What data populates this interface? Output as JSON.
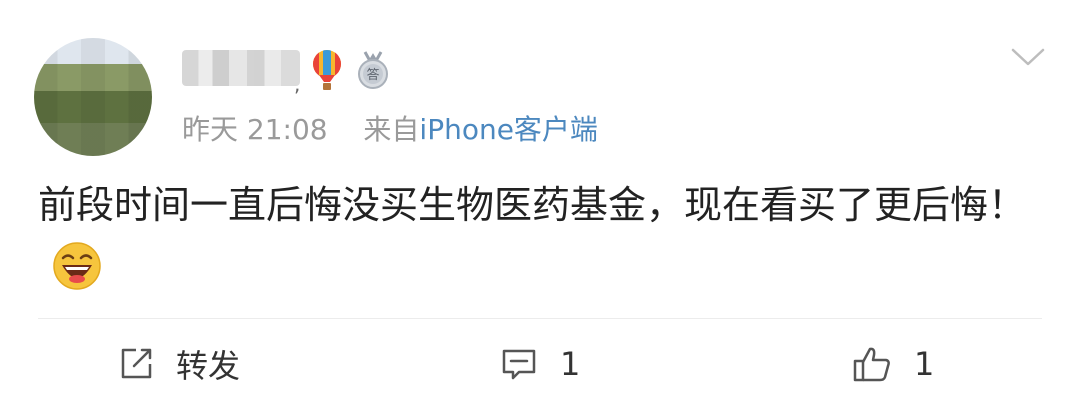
{
  "post": {
    "username_separator": ",",
    "time": "昨天 21:08",
    "source_prefix": "来自",
    "client": "iPhone客户端",
    "text": "前段时间一直后悔没买生物医药基金，现在看买了更后悔！",
    "medal_char": "答"
  },
  "actions": {
    "repost_label": "转发",
    "comment_count": "1",
    "like_count": "1"
  },
  "colors": {
    "client_link": "#4c88bf",
    "meta_gray": "#9a9a9a",
    "icon_gray": "#555555"
  },
  "icons": [
    "chevron-down-icon",
    "balloon-icon",
    "medal-icon",
    "laughing-emoji-icon",
    "repost-icon",
    "comment-icon",
    "like-icon"
  ]
}
